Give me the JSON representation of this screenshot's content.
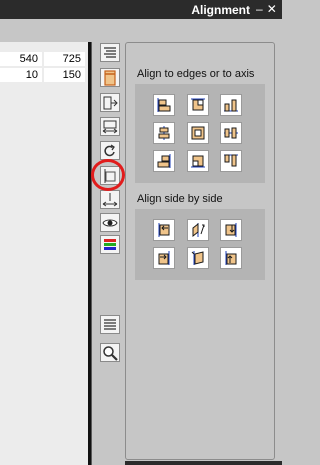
{
  "window": {
    "title": "Alignment",
    "pin_glyph": "–",
    "close_glyph": "✕"
  },
  "grid": {
    "rows": [
      [
        "540",
        "725"
      ],
      [
        "10",
        "150"
      ]
    ]
  },
  "toolbar": {
    "icons": [
      "properties-icon",
      "page-icon",
      "move-icon",
      "resize-icon",
      "rotate-icon",
      "align-icon",
      "distance-icon",
      "visibility-icon",
      "color-bars-icon",
      "list-icon",
      "zoom-icon"
    ],
    "active": "align-icon",
    "highlight_color": "#e11c1c"
  },
  "alignment": {
    "edges_label": "Align to edges or to axis",
    "side_label": "Align side by side",
    "edges_buttons": [
      "align-top-left-icon",
      "align-top-center-icon",
      "align-top-right-icon",
      "align-middle-left-icon",
      "align-middle-center-icon",
      "align-middle-right-icon",
      "align-bottom-left-icon",
      "align-bottom-center-icon",
      "align-bottom-right-icon"
    ],
    "side_buttons": [
      "side-left-top-icon",
      "side-diag-up-icon",
      "side-right-top-icon",
      "side-left-bottom-icon",
      "side-center-icon",
      "side-right-bottom-icon"
    ]
  },
  "colors": {
    "titlebar": "#2b2b2b",
    "panel": "#c6c6c6",
    "button_group": "#b4b4b4",
    "shape_fill": "#f0c48a",
    "shape_stroke": "#1a1a1a",
    "guide": "#1d3fb8"
  }
}
